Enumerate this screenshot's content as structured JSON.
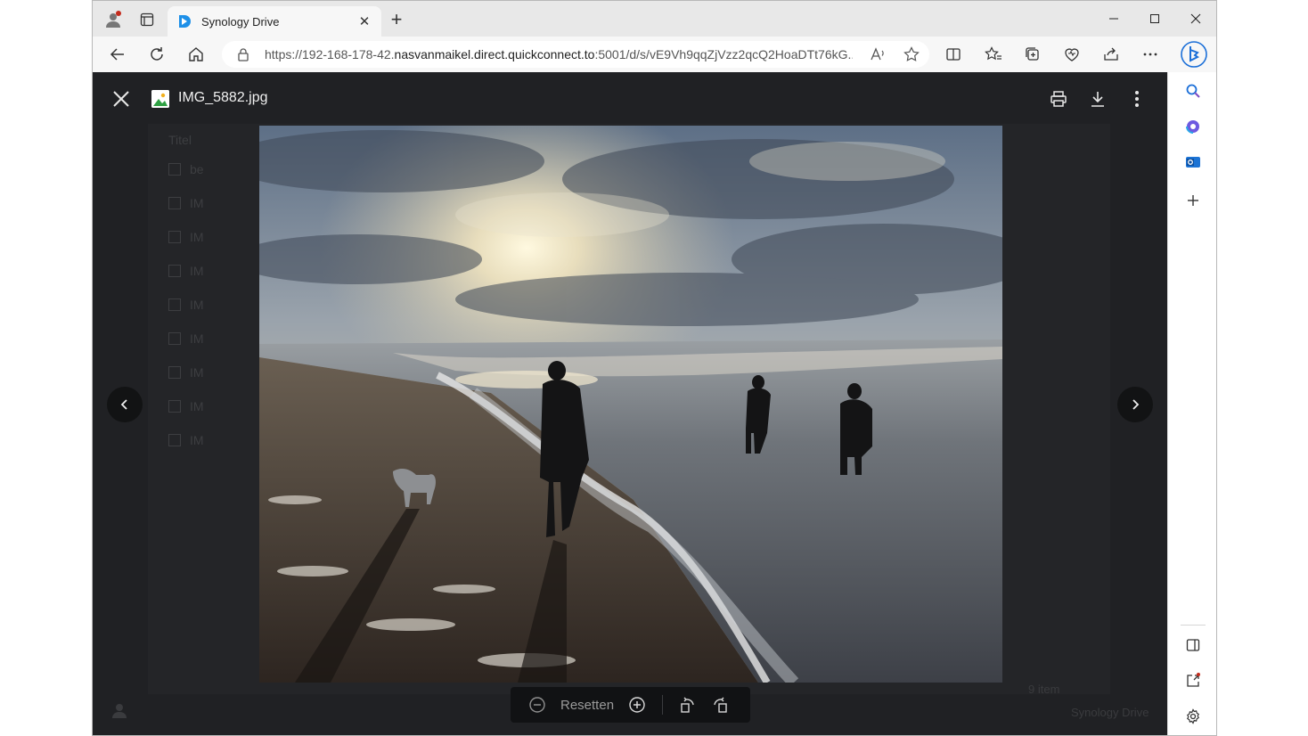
{
  "browser": {
    "tab_title": "Synology Drive",
    "url_prefix": "https://192-168-178-42.",
    "url_host": "nasvanmaikel.direct.quickconnect.to",
    "url_rest": ":5001/d/s/vE9Vh9qqZjVzz2qcQ2HoaDTt76kG..."
  },
  "viewer": {
    "file_name": "IMG_5882.jpg",
    "zoom_reset_label": "Resetten"
  },
  "background": {
    "column_header": "Titel",
    "rows": [
      "be",
      "IM",
      "IM",
      "IM",
      "IM",
      "IM",
      "IM",
      "IM",
      "IM"
    ],
    "item_count": "9 item",
    "footer_brand": "Synology Drive"
  },
  "colors": {
    "accent": "#0a6ed1",
    "viewer_bg": "#202124"
  }
}
